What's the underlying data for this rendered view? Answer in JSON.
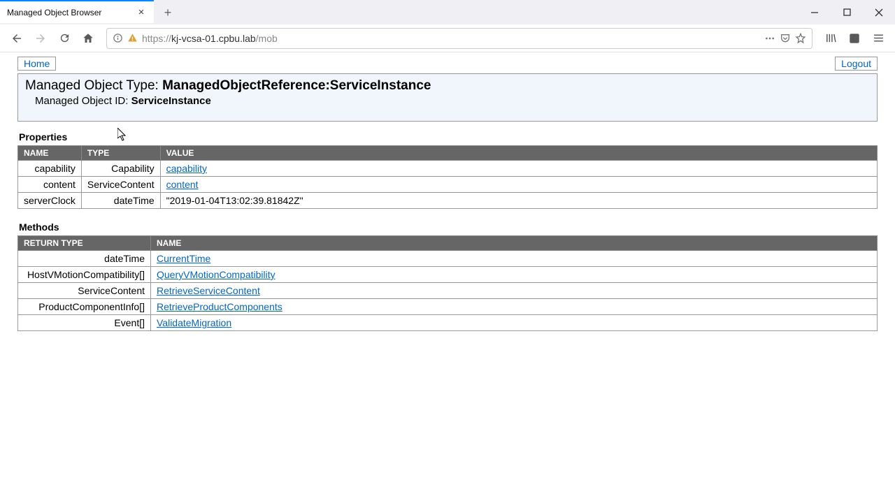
{
  "tab": {
    "title": "Managed Object Browser"
  },
  "url": {
    "prefix": "https://",
    "host": "kj-vcsa-01.cpbu.lab",
    "path": "/mob"
  },
  "nav": {
    "home_link": "Home",
    "logout_link": "Logout"
  },
  "header": {
    "type_label": "Managed Object Type: ",
    "type_value": "ManagedObjectReference:ServiceInstance",
    "id_label": "Managed Object ID: ",
    "id_value": "ServiceInstance"
  },
  "sections": {
    "properties_title": "Properties",
    "methods_title": "Methods"
  },
  "properties": {
    "headers": {
      "name": "NAME",
      "type": "TYPE",
      "value": "VALUE"
    },
    "rows": [
      {
        "name": "capability",
        "type": "Capability",
        "value": "capability",
        "is_link": true
      },
      {
        "name": "content",
        "type": "ServiceContent",
        "value": "content",
        "is_link": true
      },
      {
        "name": "serverClock",
        "type": "dateTime",
        "value": "\"2019-01-04T13:02:39.81842Z\"",
        "is_link": false
      }
    ]
  },
  "methods": {
    "headers": {
      "return_type": "RETURN TYPE",
      "name": "NAME"
    },
    "rows": [
      {
        "return_type": "dateTime",
        "name": "CurrentTime"
      },
      {
        "return_type": "HostVMotionCompatibility[]",
        "name": "QueryVMotionCompatibility"
      },
      {
        "return_type": "ServiceContent",
        "name": "RetrieveServiceContent"
      },
      {
        "return_type": "ProductComponentInfo[]",
        "name": "RetrieveProductComponents"
      },
      {
        "return_type": "Event[]",
        "name": "ValidateMigration"
      }
    ]
  }
}
